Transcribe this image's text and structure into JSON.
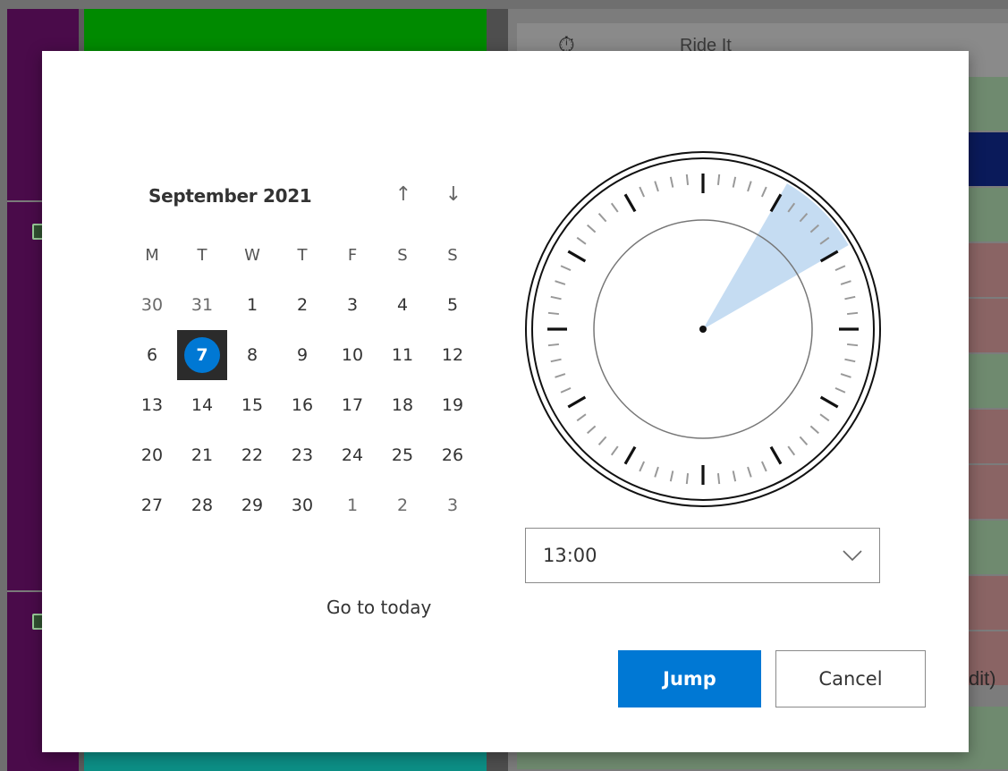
{
  "background": {
    "header_text": "Ride It",
    "right_edge_text": "dit)",
    "colors": {
      "purple": "#4a0b4a",
      "green": "#008a00",
      "teal": "#0c8f86",
      "row_red": "#8a6464",
      "row_green": "#6f8a6f",
      "row_blue": "#0a1a5a"
    }
  },
  "calendar": {
    "month_label": "September 2021",
    "prev_icon": "arrow-up-icon",
    "next_icon": "arrow-down-icon",
    "prev_glyph": "↑",
    "next_glyph": "↓",
    "weekdays": [
      "M",
      "T",
      "W",
      "T",
      "F",
      "S",
      "S"
    ],
    "weeks": [
      [
        {
          "d": "30",
          "o": true
        },
        {
          "d": "31",
          "o": true
        },
        {
          "d": "1"
        },
        {
          "d": "2"
        },
        {
          "d": "3"
        },
        {
          "d": "4"
        },
        {
          "d": "5"
        }
      ],
      [
        {
          "d": "6"
        },
        {
          "d": "7",
          "sel": true
        },
        {
          "d": "8"
        },
        {
          "d": "9"
        },
        {
          "d": "10"
        },
        {
          "d": "11"
        },
        {
          "d": "12"
        }
      ],
      [
        {
          "d": "13"
        },
        {
          "d": "14"
        },
        {
          "d": "15"
        },
        {
          "d": "16"
        },
        {
          "d": "17"
        },
        {
          "d": "18"
        },
        {
          "d": "19"
        }
      ],
      [
        {
          "d": "20"
        },
        {
          "d": "21"
        },
        {
          "d": "22"
        },
        {
          "d": "23"
        },
        {
          "d": "24"
        },
        {
          "d": "25"
        },
        {
          "d": "26"
        }
      ],
      [
        {
          "d": "27"
        },
        {
          "d": "28"
        },
        {
          "d": "29"
        },
        {
          "d": "30"
        },
        {
          "d": "1",
          "o": true
        },
        {
          "d": "2",
          "o": true
        },
        {
          "d": "3",
          "o": true
        }
      ]
    ],
    "selected_day": "7",
    "go_to_today": "Go to today"
  },
  "clock": {
    "range_start_hour": 1,
    "range_end_hour": 2,
    "highlight_color": "#c5dcf2"
  },
  "time_select": {
    "value": "13:00",
    "icon": "chevron-down-icon"
  },
  "buttons": {
    "jump": "Jump",
    "cancel": "Cancel"
  },
  "accent": "#0078d4"
}
